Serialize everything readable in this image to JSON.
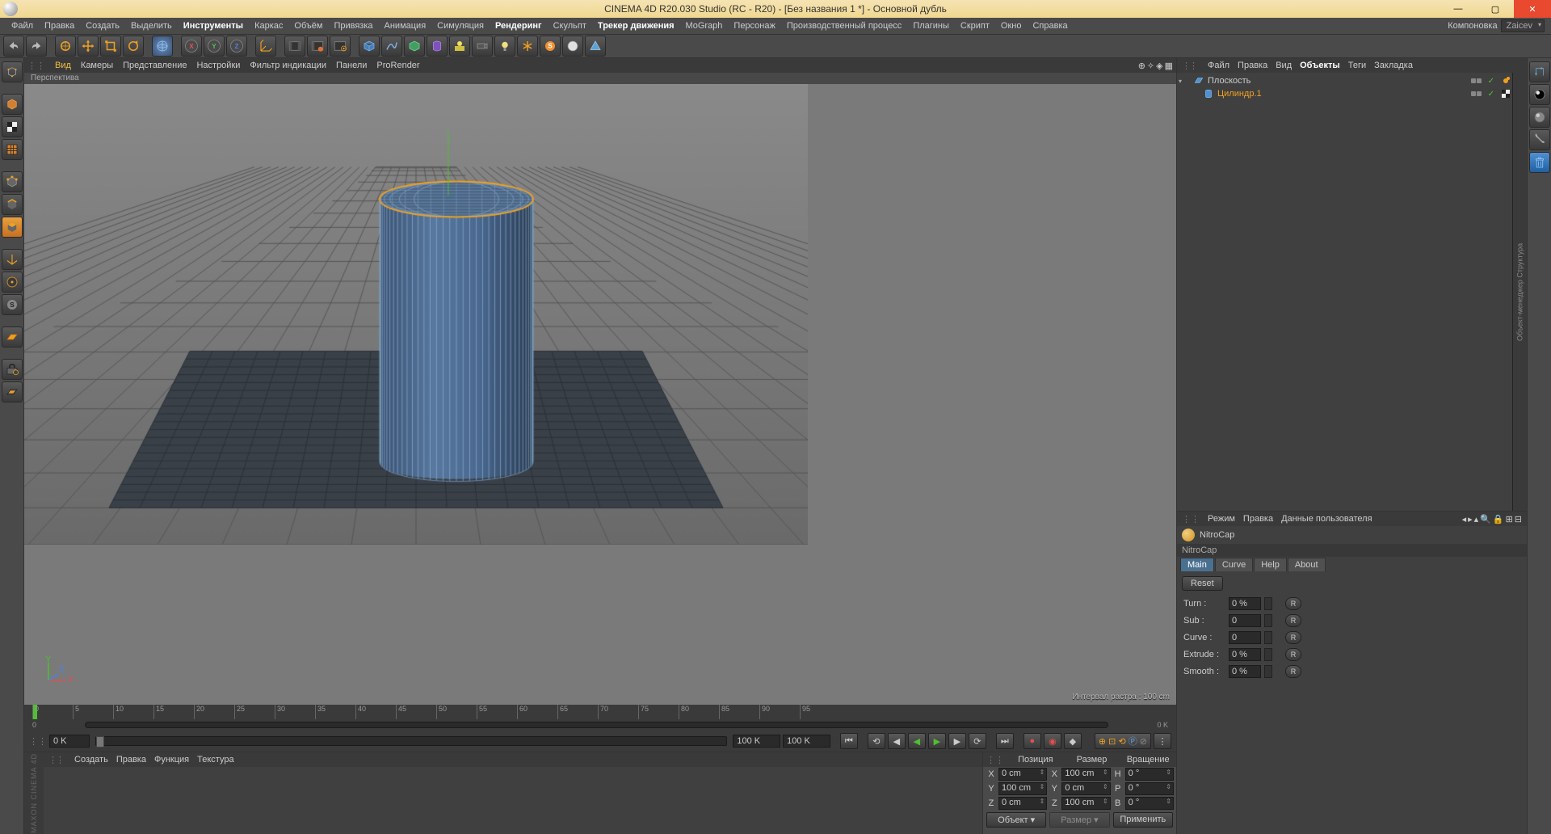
{
  "title": "CINEMA 4D R20.030 Studio (RC - R20) - [Без названия 1 *] - Основной дубль",
  "win_controls": {
    "min": "—",
    "max": "▢",
    "close": "✕"
  },
  "menubar": {
    "items": [
      "Файл",
      "Правка",
      "Создать",
      "Выделить",
      "Инструменты",
      "Каркас",
      "Объём",
      "Привязка",
      "Анимация",
      "Симуляция",
      "Рендеринг",
      "Скульпт",
      "Трекер движения",
      "MoGraph",
      "Персонаж",
      "Производственный процесс",
      "Плагины",
      "Скрипт",
      "Окно",
      "Справка"
    ],
    "bold_idx": {
      "4": true,
      "10": true,
      "12": true
    },
    "layout_label": "Компоновка",
    "layout_value": "Zaicev"
  },
  "viewport_menu": {
    "items": [
      "Вид",
      "Камеры",
      "Представление",
      "Настройки",
      "Фильтр индикации",
      "Панели",
      "ProRender"
    ],
    "active_idx": 0
  },
  "viewport_label": "Перспектива",
  "viewport_info": "Интервал растра : 100 cm",
  "timeline": {
    "start": 0,
    "end": 95,
    "step": 5,
    "marker": 0
  },
  "transport": {
    "frame_start": "0 K",
    "frame_end": "100 K",
    "frame_current": "0 K",
    "frame_max": "100 K"
  },
  "material_menu": [
    "Создать",
    "Правка",
    "Функция",
    "Текстура"
  ],
  "coords": {
    "headers": [
      "Позиция",
      "Размер",
      "Вращение"
    ],
    "rows": [
      {
        "axis": "X",
        "pos": "0 cm",
        "size": "100 cm",
        "rot_axis": "H",
        "rot": "0 °"
      },
      {
        "axis": "Y",
        "pos": "100 cm",
        "size": "0 cm",
        "rot_axis": "P",
        "rot": "0 °"
      },
      {
        "axis": "Z",
        "pos": "0 cm",
        "size": "100 cm",
        "rot_axis": "B",
        "rot": "0 °"
      }
    ],
    "dropdown1": "Объект",
    "dropdown2": "Размер",
    "apply": "Применить"
  },
  "object_manager": {
    "menu": [
      "Файл",
      "Правка",
      "Вид",
      "Объекты",
      "Теги",
      "Закладка"
    ],
    "menu_bold_idx": {
      "3": true
    },
    "items": [
      {
        "icon": "plane",
        "name": "Плоскость",
        "selected": false,
        "tag": "orange"
      },
      {
        "icon": "cylinder",
        "name": "Цилиндр.1",
        "selected": true,
        "tag": "checker"
      }
    ]
  },
  "attribute": {
    "menu": [
      "Режим",
      "Правка",
      "Данные пользователя"
    ],
    "title": "NitroCap",
    "subtitle": "NitroCap",
    "tabs": [
      "Main",
      "Curve",
      "Help",
      "About"
    ],
    "active_tab": 0,
    "reset": "Reset",
    "params": [
      {
        "label": "Turn :",
        "value": "0 %",
        "r": "R"
      },
      {
        "label": "Sub :",
        "value": "0",
        "r": "R"
      },
      {
        "label": "Curve :",
        "value": "0",
        "r": "R"
      },
      {
        "label": "Extrude :",
        "value": "0 %",
        "r": "R"
      },
      {
        "label": "Smooth :",
        "value": "0 %",
        "r": "R"
      }
    ]
  },
  "vtab_om": "Объект-менеджер  Структура",
  "maxon": "MAXON CINEMA 4D"
}
